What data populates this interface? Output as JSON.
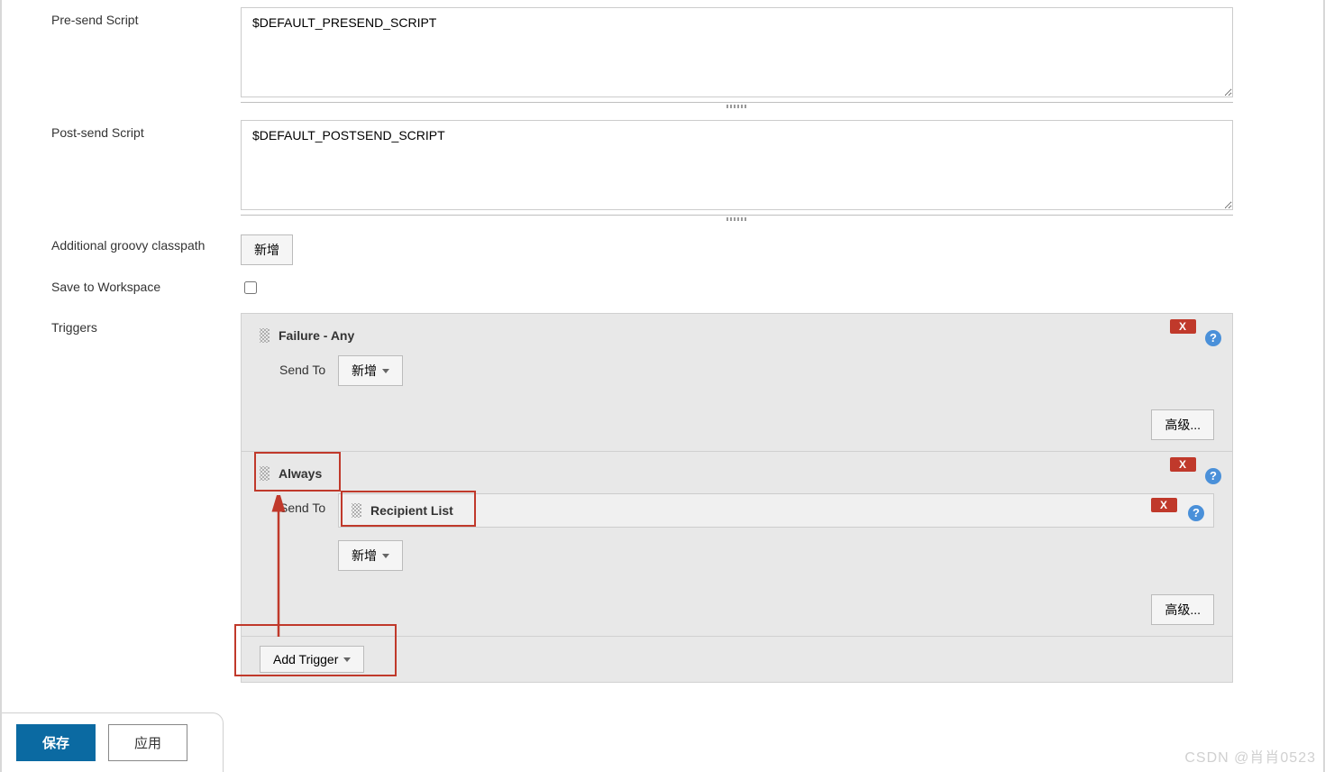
{
  "fields": {
    "presend_label": "Pre-send Script",
    "presend_value": "$DEFAULT_PRESEND_SCRIPT",
    "postsend_label": "Post-send Script",
    "postsend_value": "$DEFAULT_POSTSEND_SCRIPT",
    "classpath_label": "Additional groovy classpath",
    "classpath_add_btn": "新增",
    "save_workspace_label": "Save to Workspace",
    "triggers_label": "Triggers"
  },
  "triggers": {
    "failure_title": "Failure - Any",
    "always_title": "Always",
    "sendto_label": "Send To",
    "add_dropdown": "新增",
    "recipient_list": "Recipient List",
    "advanced_btn": "高级...",
    "add_trigger_btn": "Add Trigger",
    "delete_x": "X"
  },
  "bottom": {
    "save": "保存",
    "apply": "应用"
  },
  "watermark": "CSDN @肖肖0523",
  "help_glyph": "?"
}
